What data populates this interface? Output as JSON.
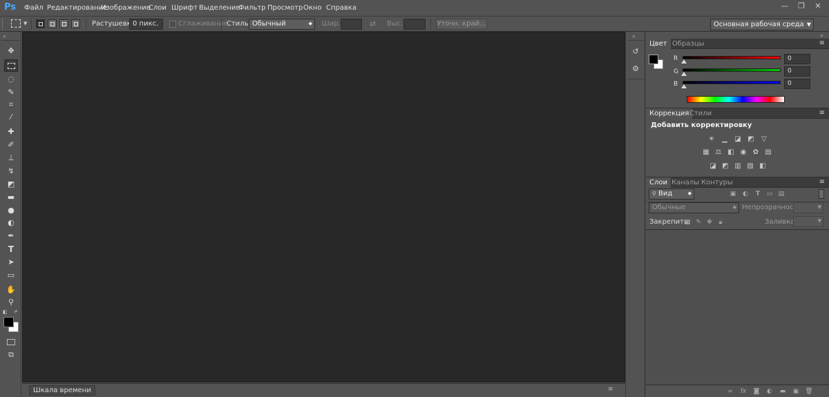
{
  "app": {
    "logo": "Ps"
  },
  "menu": [
    "Файл",
    "Редактирование",
    "Изображение",
    "Слои",
    "Шрифт",
    "Выделение",
    "Фильтр",
    "Просмотр",
    "Окно",
    "Справка"
  ],
  "window_controls": {
    "minimize": "—",
    "restore": "❐",
    "close": "✕"
  },
  "options": {
    "feather_label": "Растушевка:",
    "feather_value": "0 пикс.",
    "antialias_label": "Сглаживание",
    "style_label": "Стиль:",
    "style_value": "Обычный",
    "width_label": "Шир.:",
    "height_label": "Выс.:",
    "refine_edge": "Уточн. край...",
    "workspace": "Основная рабочая среда"
  },
  "timeline": {
    "tab": "Шкала времени"
  },
  "color_panel": {
    "tabs": [
      "Цвет",
      "Образцы"
    ],
    "channels": [
      {
        "label": "R",
        "value": "0",
        "color": "#ff0000"
      },
      {
        "label": "G",
        "value": "0",
        "color": "#00cc00"
      },
      {
        "label": "B",
        "value": "0",
        "color": "#0000ff"
      }
    ],
    "foreground": "#000000",
    "background": "#ffffff"
  },
  "adjustments_panel": {
    "tabs": [
      "Коррекция",
      "Стили"
    ],
    "heading": "Добавить корректировку"
  },
  "layers_panel": {
    "tabs": [
      "Слои",
      "Каналы",
      "Контуры"
    ],
    "filter_kind": "Вид",
    "blend_mode": "Обычные",
    "opacity_label": "Непрозрачность:",
    "lock_label": "Закрепить:",
    "fill_label": "Заливка:"
  }
}
